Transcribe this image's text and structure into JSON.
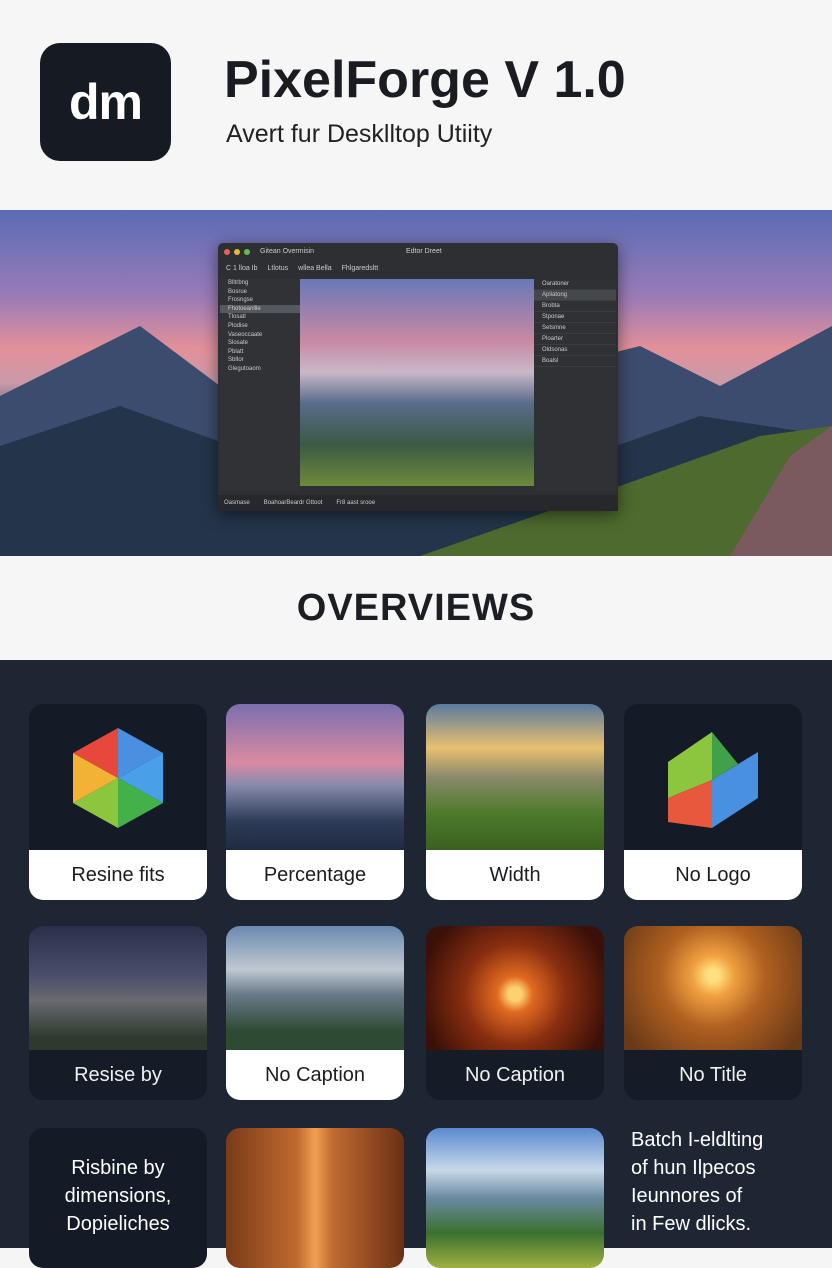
{
  "header": {
    "app_icon": "dm",
    "title": "PixelForge V 1.0",
    "subtitle": "Avert fur Desklltop Utiity"
  },
  "hero": {
    "window": {
      "title_left": "Gitean Overmisin",
      "title_center": "Edtor Dreet",
      "toolbar": [
        "C 1 lloa Ib",
        "Ltlotus",
        "wllea Bella",
        "Fhlgaredsltt"
      ],
      "left_panel": [
        "Blltrbng",
        "Bosrue",
        "Frosngse",
        "Fhotoeanllle",
        "Tlosatl",
        "Plodise",
        "Vaseoccaate",
        "Slosate",
        "Pblatt",
        "Sbltor",
        "Glegutoaom"
      ],
      "right_panel": [
        "Oaratoner",
        "Apliatong",
        "Brobta",
        "Stponae",
        "Setsmne",
        "Ploarter",
        "Oldsonas",
        "Boalsl"
      ],
      "status": [
        "Oasmase",
        "BoahoarBeardr Gttoot",
        "Fr8 aast srooe"
      ]
    }
  },
  "overview": {
    "heading": "OVERVIEWS",
    "cards": [
      {
        "label": "Resine fits"
      },
      {
        "label": "Percentage"
      },
      {
        "label": "Width"
      },
      {
        "label": "No Logo"
      },
      {
        "label": "Resise by"
      },
      {
        "label": "No Caption"
      },
      {
        "label": "No Caption"
      },
      {
        "label": "No Title"
      }
    ],
    "text_card_left": [
      "Risbine by",
      "dimensions,",
      "Dopieliches"
    ],
    "text_card_right": [
      "Batch I‑eldlting",
      "of hun Ilpecos",
      "Ieunnores of",
      "in Few dlicks."
    ]
  },
  "colors": {
    "dark_bg": "#1f2633",
    "card_bg": "#141a26"
  }
}
